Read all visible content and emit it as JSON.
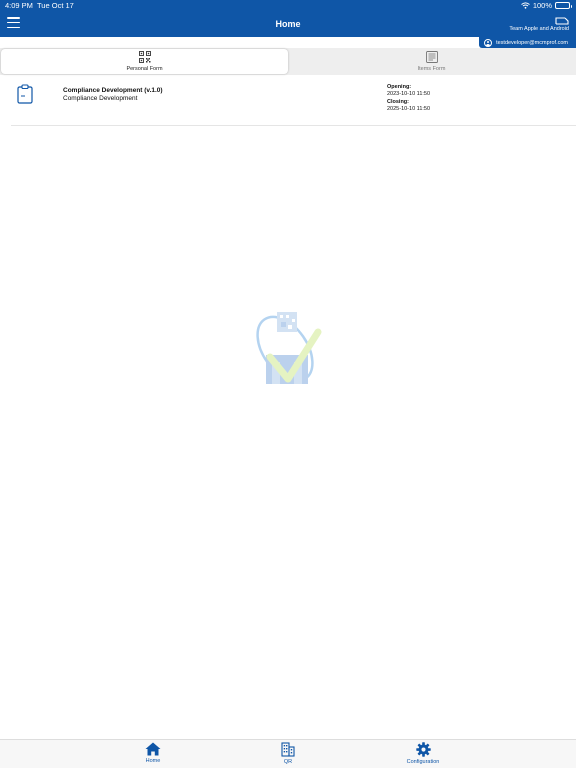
{
  "status_bar": {
    "time": "4:09 PM",
    "date": "Tue Oct 17",
    "battery": "100%",
    "battery_level": 1.0
  },
  "header": {
    "title": "Home",
    "team_label": "Team Apple and Android",
    "user_email": "testdeveloper@mcmprof.com",
    "background_color": "#0f56a7"
  },
  "tabs": [
    {
      "label": "Personal Form",
      "icon": "qr-code-icon",
      "active": true
    },
    {
      "label": "Items Form",
      "icon": "document-icon",
      "active": false
    }
  ],
  "forms": [
    {
      "title": "Compliance Development (v.1.0)",
      "subtitle": "Compliance Development",
      "opening_label": "Opening:",
      "opening_value": "2023-10-10 11:50",
      "closing_label": "Closing:",
      "closing_value": "2025-10-10 11:50",
      "icon": "clipboard-icon"
    }
  ],
  "bottom_nav": [
    {
      "label": "Home",
      "icon": "home-icon"
    },
    {
      "label": "QR",
      "icon": "building-icon"
    },
    {
      "label": "Configuration",
      "icon": "gear-icon"
    }
  ]
}
